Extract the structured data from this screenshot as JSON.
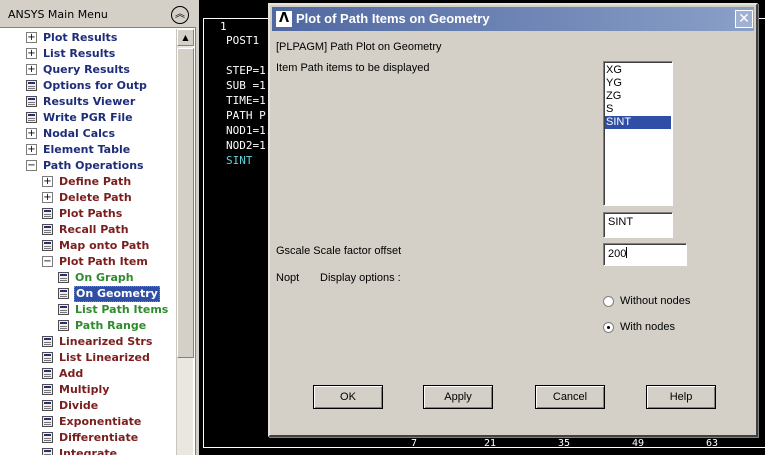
{
  "menu": {
    "title": "ANSYS Main Menu",
    "items": [
      {
        "label": "Plot Results",
        "icon": "expand",
        "depth": 1,
        "color": "blue"
      },
      {
        "label": "List Results",
        "icon": "expand",
        "depth": 1,
        "color": "blue"
      },
      {
        "label": "Query Results",
        "icon": "expand",
        "depth": 1,
        "color": "blue"
      },
      {
        "label": "Options for Outp",
        "icon": "doc",
        "depth": 1,
        "color": "blue"
      },
      {
        "label": "Results Viewer",
        "icon": "doc",
        "depth": 1,
        "color": "blue"
      },
      {
        "label": "Write PGR File",
        "icon": "doc",
        "depth": 1,
        "color": "blue"
      },
      {
        "label": "Nodal Calcs",
        "icon": "expand",
        "depth": 1,
        "color": "blue"
      },
      {
        "label": "Element Table",
        "icon": "expand",
        "depth": 1,
        "color": "blue"
      },
      {
        "label": "Path Operations",
        "icon": "collapse",
        "depth": 1,
        "color": "blue"
      },
      {
        "label": "Define Path",
        "icon": "expand",
        "depth": 2,
        "color": "red"
      },
      {
        "label": "Delete Path",
        "icon": "expand",
        "depth": 2,
        "color": "red"
      },
      {
        "label": "Plot Paths",
        "icon": "doc",
        "depth": 2,
        "color": "red"
      },
      {
        "label": "Recall Path",
        "icon": "doc",
        "depth": 2,
        "color": "red"
      },
      {
        "label": "Map onto Path",
        "icon": "doc",
        "depth": 2,
        "color": "red"
      },
      {
        "label": "Plot Path Item",
        "icon": "collapse",
        "depth": 2,
        "color": "red"
      },
      {
        "label": "On Graph",
        "icon": "doc",
        "depth": 3,
        "color": "green"
      },
      {
        "label": "On Geometry",
        "icon": "doc",
        "depth": 3,
        "color": "green",
        "selected": true
      },
      {
        "label": "List Path Items",
        "icon": "doc",
        "depth": 3,
        "color": "green"
      },
      {
        "label": "Path Range",
        "icon": "doc",
        "depth": 3,
        "color": "green"
      },
      {
        "label": "Linearized Strs",
        "icon": "doc",
        "depth": 2,
        "color": "red"
      },
      {
        "label": "List Linearized",
        "icon": "doc",
        "depth": 2,
        "color": "red"
      },
      {
        "label": "Add",
        "icon": "doc",
        "depth": 2,
        "color": "red"
      },
      {
        "label": "Multiply",
        "icon": "doc",
        "depth": 2,
        "color": "red"
      },
      {
        "label": "Divide",
        "icon": "doc",
        "depth": 2,
        "color": "red"
      },
      {
        "label": "Exponentiate",
        "icon": "doc",
        "depth": 2,
        "color": "red"
      },
      {
        "label": "Differentiate",
        "icon": "doc",
        "depth": 2,
        "color": "red"
      },
      {
        "label": "Integrate",
        "icon": "doc",
        "depth": 2,
        "color": "red"
      }
    ]
  },
  "graphics": {
    "window_number": "1",
    "lines": [
      "POST1",
      "",
      "STEP=1",
      "SUB =1",
      "TIME=1",
      "PATH P",
      "NOD1=1",
      "NOD2=1",
      "SINT"
    ],
    "axis_ticks": [
      "7",
      "21",
      "35",
      "49",
      "63"
    ]
  },
  "dialog": {
    "title": "Plot of Path Items on Geometry",
    "command": "[PLPAGM]  Path Plot on Geometry",
    "item_label": "Item  Path items to be displayed",
    "item_options": [
      "XG",
      "YG",
      "ZG",
      "S",
      "SINT"
    ],
    "item_selected": "SINT",
    "item_value": "SINT",
    "gscale_label": "Gscale   Scale factor offset",
    "gscale_value": "200",
    "nopt_label": "Nopt",
    "nopt_desc": "Display options :",
    "radio_without": "Without nodes",
    "radio_with": "With nodes",
    "radio_selected": "With nodes",
    "buttons": {
      "ok": "OK",
      "apply": "Apply",
      "cancel": "Cancel",
      "help": "Help"
    }
  },
  "colors": {
    "blue": "#1e2d7a",
    "red": "#7a1e1e",
    "green": "#2e8b2e",
    "cyan_text": "#5fd3d8",
    "selection": "#2f4fa6"
  }
}
